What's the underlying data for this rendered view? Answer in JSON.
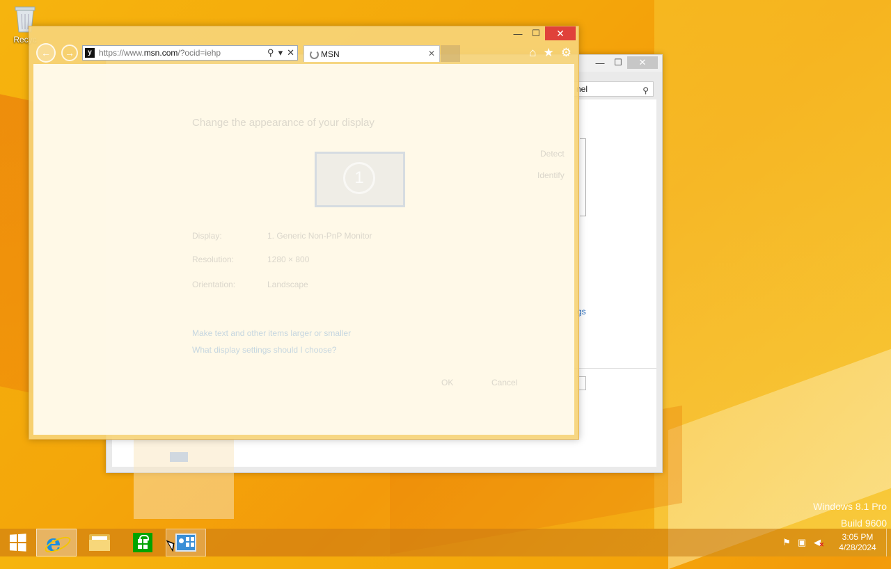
{
  "desktop": {
    "recycle_bin_label": "Recyc",
    "watermark_line1": "Windows 8.1 Pro",
    "watermark_line2": "Build 9600"
  },
  "control_panel_window": {
    "search_text": "nel",
    "link_text": "gs",
    "controls": {
      "minimize": "—",
      "maximize": "☐",
      "close": "✕"
    }
  },
  "ie": {
    "address_url_prefix": "https://www.",
    "address_url_domain": "msn.com",
    "address_url_rest": "/?ocid=iehp",
    "favicon_letter": "y",
    "tab_title": "MSN",
    "tab_close": "✕",
    "controls": {
      "minimize": "—",
      "maximize": "☐",
      "close": "✕"
    },
    "ghost": {
      "title": "Change the appearance of your display",
      "detect": "Detect",
      "identify": "Identify",
      "display_label": "Display:",
      "display_value": "1. Generic Non-PnP Monitor",
      "resolution_label": "Resolution:",
      "resolution_value": "1280 × 800",
      "orientation_label": "Orientation:",
      "orientation_value": "Landscape",
      "link1": "Make text and other items larger or smaller",
      "link2": "What display settings should I choose?",
      "ok": "OK",
      "cancel": "Cancel"
    }
  },
  "taskbar": {
    "items": [
      "start",
      "internet-explorer",
      "file-explorer",
      "store",
      "control-panel"
    ],
    "clock_time": "3:05 PM",
    "clock_date": "4/28/2024"
  }
}
